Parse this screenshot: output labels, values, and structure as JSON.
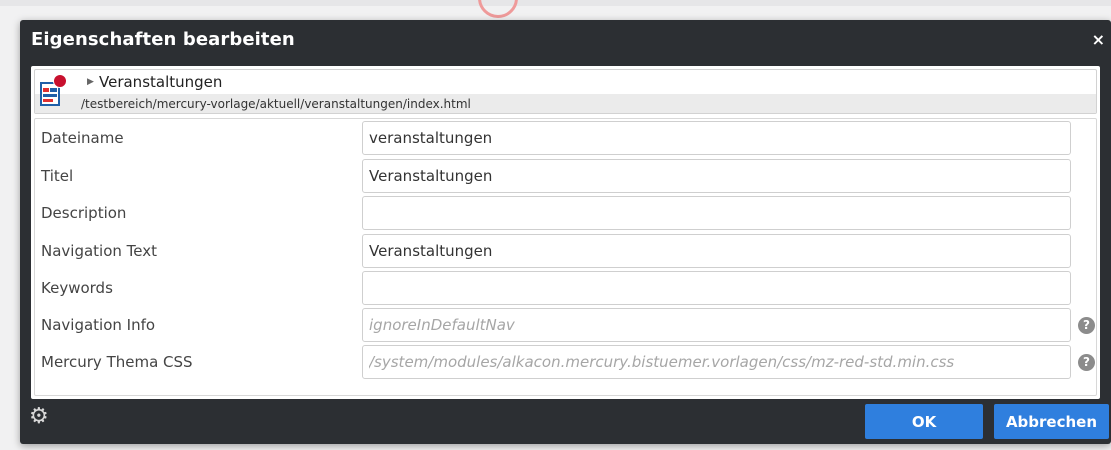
{
  "dialog": {
    "title": "Eigenschaften bearbeiten",
    "close_label": "×"
  },
  "resource": {
    "name": "Veranstaltungen",
    "path": "/testbereich/mercury-vorlage/aktuell/veranstaltungen/index.html",
    "icon": "page-icon"
  },
  "properties": [
    {
      "label": "Dateiname",
      "value": "veranstaltungen",
      "placeholder": ""
    },
    {
      "label": "Titel",
      "value": "Veranstaltungen",
      "placeholder": ""
    },
    {
      "label": "Description",
      "value": "",
      "placeholder": ""
    },
    {
      "label": "Navigation Text",
      "value": "Veranstaltungen",
      "placeholder": ""
    },
    {
      "label": "Keywords",
      "value": "",
      "placeholder": ""
    },
    {
      "label": "Navigation Info",
      "value": "",
      "placeholder": "ignoreInDefaultNav",
      "help": "?"
    },
    {
      "label": "Mercury Thema CSS",
      "value": "",
      "placeholder": "/system/modules/alkacon.mercury.bistuemer.vorlagen/css/mz-red-std.min.css",
      "help": "?"
    }
  ],
  "footer": {
    "ok_label": "OK",
    "cancel_label": "Abbrechen",
    "settings_icon": "gear-icon"
  },
  "colors": {
    "dialog_bg": "#2c2f33",
    "button_blue": "#2f7fde",
    "accent_red": "#c8102e"
  }
}
